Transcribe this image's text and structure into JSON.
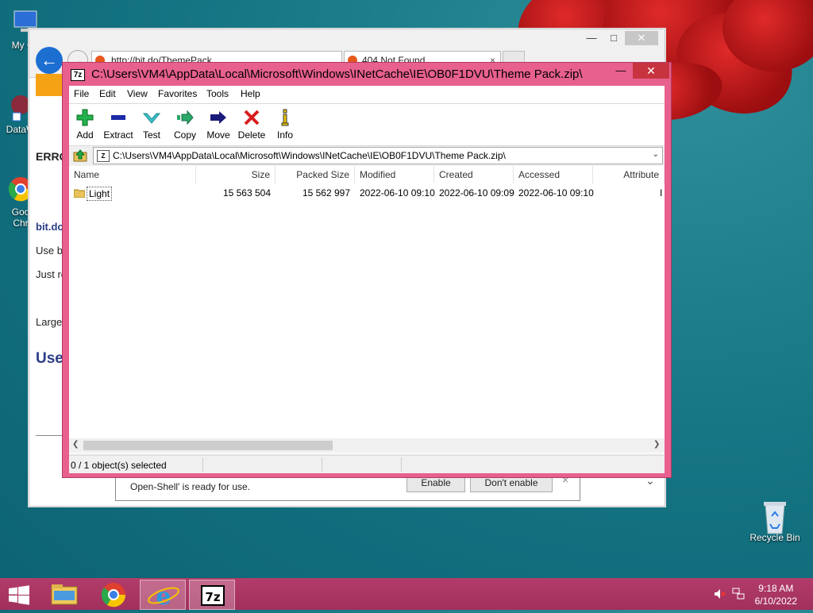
{
  "desktop": {
    "icons": [
      {
        "label": "My Co"
      },
      {
        "label": "DataW"
      },
      {
        "label": "Goo Chr"
      },
      {
        "label": "Recycle Bin"
      }
    ]
  },
  "ie": {
    "address": "http://bit.do/ThemePack",
    "tab_label": "404 Not Found",
    "side_texts": [
      "ERRO",
      "bit.do",
      "Use b",
      "Just re",
      "Large",
      "Use"
    ],
    "notification": {
      "text": "Open-Shell' is ready for use.",
      "enable": "Enable",
      "dont_enable": "Don't enable"
    }
  },
  "zip": {
    "title": "C:\\Users\\VM4\\AppData\\Local\\Microsoft\\Windows\\INetCache\\IE\\OB0F1DVU\\Theme Pack.zip\\",
    "menu": [
      "File",
      "Edit",
      "View",
      "Favorites",
      "Tools",
      "Help"
    ],
    "toolbar": {
      "add": "Add",
      "extract": "Extract",
      "test": "Test",
      "copy": "Copy",
      "move": "Move",
      "delete": "Delete",
      "info": "Info"
    },
    "path": "C:\\Users\\VM4\\AppData\\Local\\Microsoft\\Windows\\INetCache\\IE\\OB0F1DVU\\Theme Pack.zip\\",
    "columns": [
      "Name",
      "Size",
      "Packed Size",
      "Modified",
      "Created",
      "Accessed",
      "Attribute"
    ],
    "rows": [
      {
        "name": "Light",
        "size": "15 563 504",
        "packed": "15 562 997",
        "modified": "2022-06-10 09:10",
        "created": "2022-06-10 09:09",
        "accessed": "2022-06-10 09:10",
        "attr": "I"
      }
    ],
    "status": "0 / 1 object(s) selected"
  },
  "taskbar": {
    "time": "9:18 AM",
    "date": "6/10/2022"
  }
}
